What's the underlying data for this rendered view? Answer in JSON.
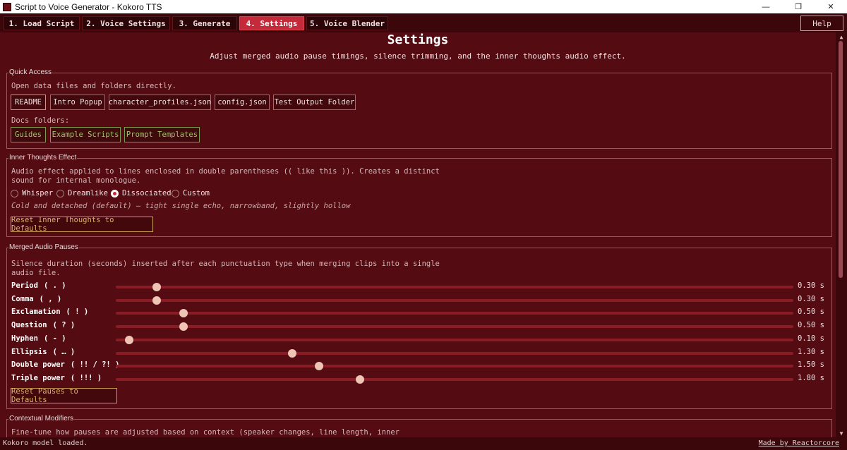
{
  "window": {
    "title": "Script to Voice Generator - Kokoro TTS",
    "minimize": "—",
    "maximize": "❐",
    "close": "✕"
  },
  "tabs": [
    "1. Load Script",
    "2. Voice Settings",
    "3. Generate",
    "4. Settings",
    "5. Voice Blender"
  ],
  "active_tab": "4. Settings",
  "help_label": "Help",
  "page": {
    "title": "Settings",
    "subtitle": "Adjust merged audio pause timings, silence trimming, and the inner thoughts audio effect."
  },
  "quick_access": {
    "label": "Quick Access",
    "desc": "Open data files and folders directly.",
    "buttons": [
      "README",
      "Intro Popup",
      "character_profiles.json",
      "config.json",
      "Test Output Folder"
    ],
    "docs_label": "Docs folders:",
    "doc_buttons": [
      "Guides",
      "Example Scripts",
      "Prompt Templates"
    ]
  },
  "inner_thoughts": {
    "label": "Inner Thoughts Effect",
    "desc_line1": "Audio effect applied to lines enclosed in double parentheses (( like this )). Creates a distinct",
    "desc_line2": "sound for internal monologue.",
    "options": [
      "Whisper",
      "Dreamlike",
      "Dissociated",
      "Custom"
    ],
    "selected": "Dissociated",
    "note": "Cold and detached (default) — tight single echo, narrowband, slightly hollow",
    "reset_label": "Reset Inner Thoughts to Defaults"
  },
  "merged_pauses": {
    "label": "Merged Audio Pauses",
    "desc_line1": "Silence duration (seconds) inserted after each punctuation type when merging clips into a single",
    "desc_line2": "audio file.",
    "slider_max": 5.0,
    "rows": [
      {
        "name": "Period",
        "symbol": "( . )",
        "value": 0.3,
        "display": "0.30 s"
      },
      {
        "name": "Comma",
        "symbol": "( , )",
        "value": 0.3,
        "display": "0.30 s"
      },
      {
        "name": "Exclamation",
        "symbol": "( ! )",
        "value": 0.5,
        "display": "0.50 s"
      },
      {
        "name": "Question",
        "symbol": "( ? )",
        "value": 0.5,
        "display": "0.50 s"
      },
      {
        "name": "Hyphen",
        "symbol": "( - )",
        "value": 0.1,
        "display": "0.10 s"
      },
      {
        "name": "Ellipsis",
        "symbol": "( … )",
        "value": 1.3,
        "display": "1.30 s"
      },
      {
        "name": "Double power",
        "symbol": "( !! / ?! )",
        "value": 1.5,
        "display": "1.50 s"
      },
      {
        "name": "Triple power",
        "symbol": "( !!! )",
        "value": 1.8,
        "display": "1.80 s"
      }
    ],
    "reset_label": "Reset Pauses to Defaults"
  },
  "contextual": {
    "label": "Contextual Modifiers",
    "desc_line1": "Fine-tune how pauses are adjusted based on context (speaker changes, line length, inner"
  },
  "status": {
    "text": "Kokoro model loaded.",
    "credit": "Made by Reactorcore"
  }
}
